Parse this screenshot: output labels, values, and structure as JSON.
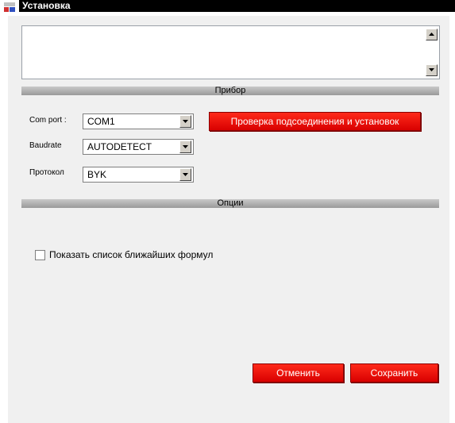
{
  "window": {
    "title": "Установка",
    "icon": "app-icon"
  },
  "sections": {
    "device": "Прибор",
    "options": "Опции"
  },
  "fields": {
    "com_port": {
      "label": "Com port :",
      "value": "COM1"
    },
    "baudrate": {
      "label": "Baudrate",
      "value": "AUTODETECT"
    },
    "protocol": {
      "label": "Протокол",
      "value": "BYK"
    }
  },
  "buttons": {
    "check_connection": "Проверка подсоединения и установок",
    "cancel": "Отменить",
    "save": "Сохранить"
  },
  "options": {
    "show_nearest_formulas": {
      "label": "Показать список ближайших формул",
      "checked": false
    }
  },
  "colors": {
    "accent": "#e80000",
    "header_gradient": "#b4b4b4",
    "panel": "#f0f0f0"
  }
}
